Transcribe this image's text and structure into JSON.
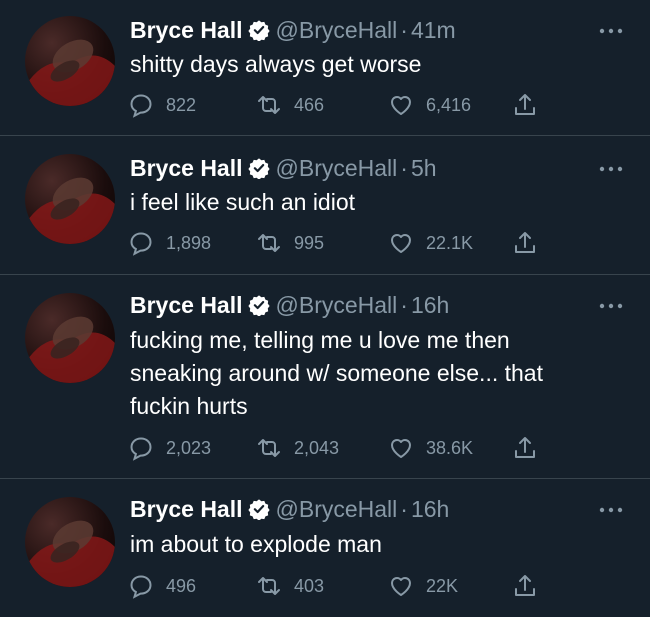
{
  "colors": {
    "background": "#15202b",
    "text_primary": "#ffffff",
    "text_secondary": "#8899a6",
    "divider": "#38444d"
  },
  "tweets": [
    {
      "name": "Bryce Hall",
      "handle": "@BryceHall",
      "separator": "·",
      "time": "41m",
      "text": "shitty days always get worse",
      "replies": "822",
      "retweets": "466",
      "likes": "6,416"
    },
    {
      "name": "Bryce Hall",
      "handle": "@BryceHall",
      "separator": "·",
      "time": "5h",
      "text": "i feel like such an idiot",
      "replies": "1,898",
      "retweets": "995",
      "likes": "22.1K"
    },
    {
      "name": "Bryce Hall",
      "handle": "@BryceHall",
      "separator": "·",
      "time": "16h",
      "text": "fucking me, telling me u love me then sneaking around w/ someone else... that fuckin hurts",
      "replies": "2,023",
      "retweets": "2,043",
      "likes": "38.6K"
    },
    {
      "name": "Bryce Hall",
      "handle": "@BryceHall",
      "separator": "·",
      "time": "16h",
      "text": "im about to explode man",
      "replies": "496",
      "retweets": "403",
      "likes": "22K"
    }
  ],
  "icons": {
    "verified": "verified-badge-icon",
    "more": "more-options-icon",
    "reply": "reply-icon",
    "retweet": "retweet-icon",
    "like": "heart-icon",
    "share": "share-icon"
  }
}
